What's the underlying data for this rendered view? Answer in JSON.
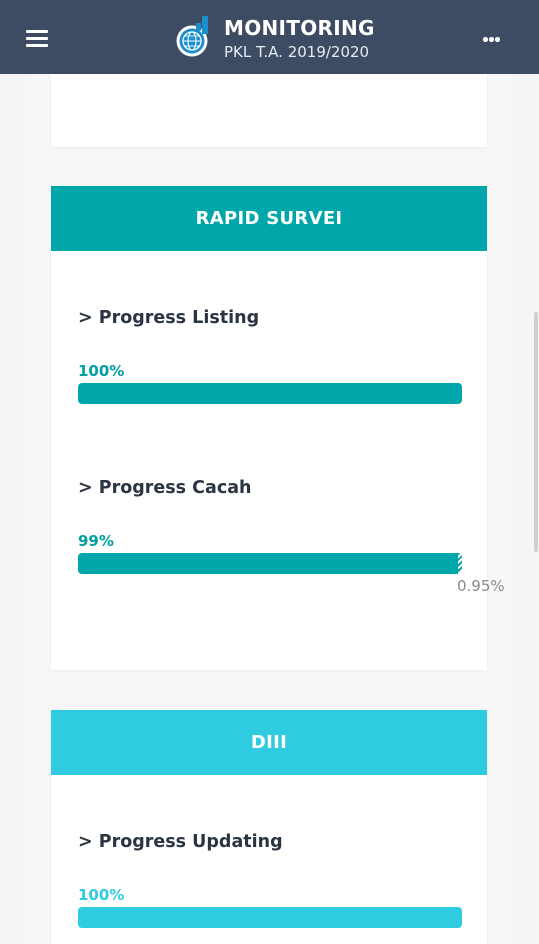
{
  "header": {
    "title": "MONITORING",
    "subtitle": "PKL T.A. 2019/2020"
  },
  "sections": [
    {
      "title": "RAPID SURVEI",
      "color": "#00a7aa",
      "items": [
        {
          "label": "> Progress Listing",
          "value_text": "100%",
          "percent": 100
        },
        {
          "label": "> Progress Cacah",
          "value_text": "99%",
          "percent": 99.05,
          "remaining_text": "0.95%"
        }
      ]
    },
    {
      "title": "DIII",
      "color": "#2ecbe1",
      "items": [
        {
          "label": "> Progress Updating",
          "value_text": "100%",
          "percent": 100
        }
      ]
    }
  ],
  "colors": {
    "appbar": "#3d4b63",
    "teal": "#00a7aa",
    "cyan": "#2ecbe1"
  },
  "icons": [
    "menu-icon",
    "bps-logo",
    "more-horizontal-icon"
  ]
}
